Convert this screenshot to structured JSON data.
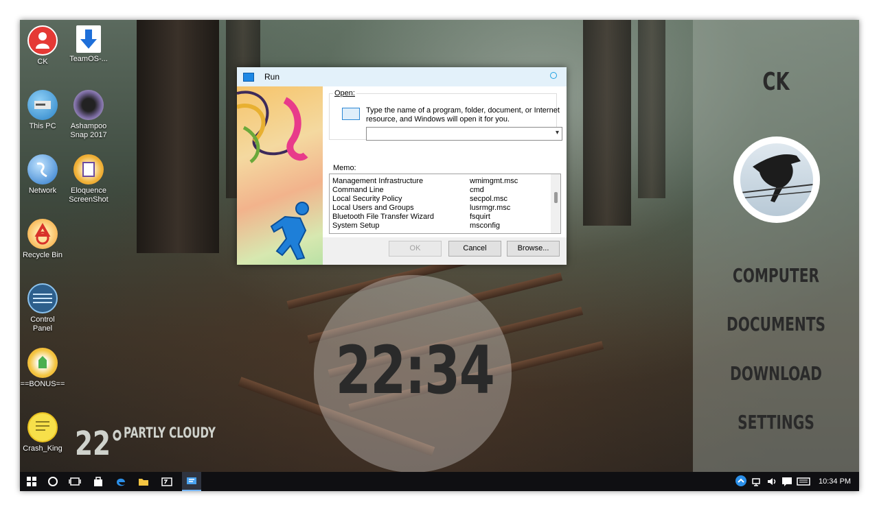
{
  "desktop_icons": [
    {
      "label": "CK",
      "icon": "user-icon",
      "color": "#e53935"
    },
    {
      "label": "TeamOS-...",
      "icon": "download-arrow-icon",
      "color": "#1e6fd9"
    },
    {
      "label": "This PC",
      "icon": "computer-icon",
      "color": "#4aa3df"
    },
    {
      "label": "Ashampoo Snap 2017",
      "icon": "camera-icon",
      "color": "#5a4a7a"
    },
    {
      "label": "Network",
      "icon": "globe-icon",
      "color": "#3d8fd8"
    },
    {
      "label": "Eloquence ScreenShot",
      "icon": "screenshot-icon",
      "color": "#e8a83a"
    },
    {
      "label": "Recycle Bin",
      "icon": "recycle-icon",
      "color": "#e53935"
    },
    {
      "label": "Control Panel",
      "icon": "control-panel-icon",
      "color": "#2a7bbf"
    },
    {
      "label": "==BONUS==",
      "icon": "bonus-icon",
      "color": "#f4c542"
    },
    {
      "label": "Crash_King",
      "icon": "notepad-icon",
      "color": "#f7e04a"
    }
  ],
  "widgets": {
    "clock": "22:34",
    "temperature": "22°",
    "condition": "PARTLY CLOUDY"
  },
  "right_panel": {
    "username": "CK",
    "links": [
      "COMPUTER",
      "DOCUMENTS",
      "DOWNLOAD",
      "SETTINGS"
    ]
  },
  "run_dialog": {
    "title": "Run",
    "open_label": "Open:",
    "description": "Type the name of a program, folder, document, or Internet resource, and Windows will open it for you.",
    "input_value": "",
    "memo_label": "Memo:",
    "memo_rows": [
      {
        "name": "Management Infrastructure",
        "command": "wmimgmt.msc"
      },
      {
        "name": "Command Line",
        "command": "cmd"
      },
      {
        "name": "Local Security Policy",
        "command": "secpol.msc"
      },
      {
        "name": "Local Users and Groups",
        "command": "lusrmgr.msc"
      },
      {
        "name": "Bluetooth File Transfer Wizard",
        "command": "fsquirt"
      },
      {
        "name": "System Setup",
        "command": "msconfig"
      }
    ],
    "buttons": {
      "ok": "OK",
      "cancel": "Cancel",
      "browse": "Browse..."
    }
  },
  "taskbar": {
    "time": "10:34 PM"
  }
}
